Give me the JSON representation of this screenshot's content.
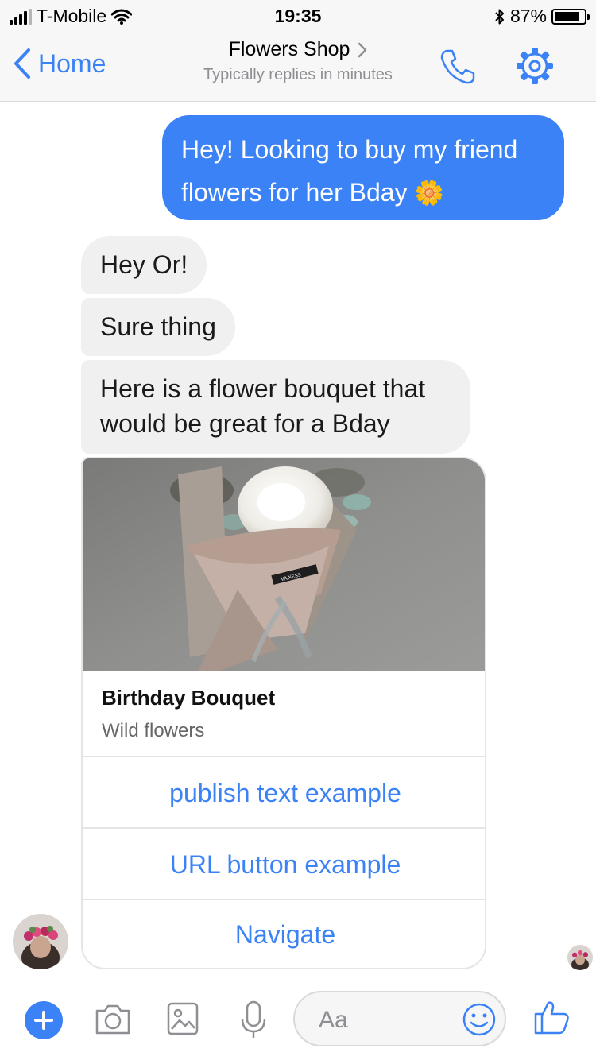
{
  "status_bar": {
    "carrier": "T-Mobile",
    "time": "19:35",
    "battery_percent": "87%",
    "battery_level": 0.87
  },
  "nav": {
    "back_label": "Home",
    "title": "Flowers Shop",
    "subtitle": "Typically replies in minutes"
  },
  "messages": {
    "outgoing": [
      {
        "text": "Hey! Looking to buy my friend flowers for her Bday",
        "emoji": "🌼"
      }
    ],
    "incoming": [
      {
        "text": "Hey Or!"
      },
      {
        "text": "Sure thing"
      },
      {
        "text": "Here is a flower bouquet that would be great for a Bday"
      }
    ]
  },
  "card": {
    "image_label": "VANESS",
    "title": "Birthday Bouquet",
    "subtitle": "Wild flowers",
    "buttons": [
      {
        "label": "publish text example"
      },
      {
        "label": "URL button example"
      },
      {
        "label": "Navigate"
      }
    ]
  },
  "composer": {
    "placeholder": "Aa"
  },
  "colors": {
    "accent": "#3b82f6",
    "incoming_bubble": "#f0f0f0",
    "bar_bg": "#f7f7f7"
  },
  "icons": [
    "signal-icon",
    "wifi-icon",
    "bluetooth-icon",
    "battery-icon",
    "back-chevron-icon",
    "chevron-right-icon",
    "phone-icon",
    "gear-icon",
    "plus-icon",
    "camera-icon",
    "image-icon",
    "microphone-icon",
    "emoji-icon",
    "thumbs-up-icon"
  ]
}
